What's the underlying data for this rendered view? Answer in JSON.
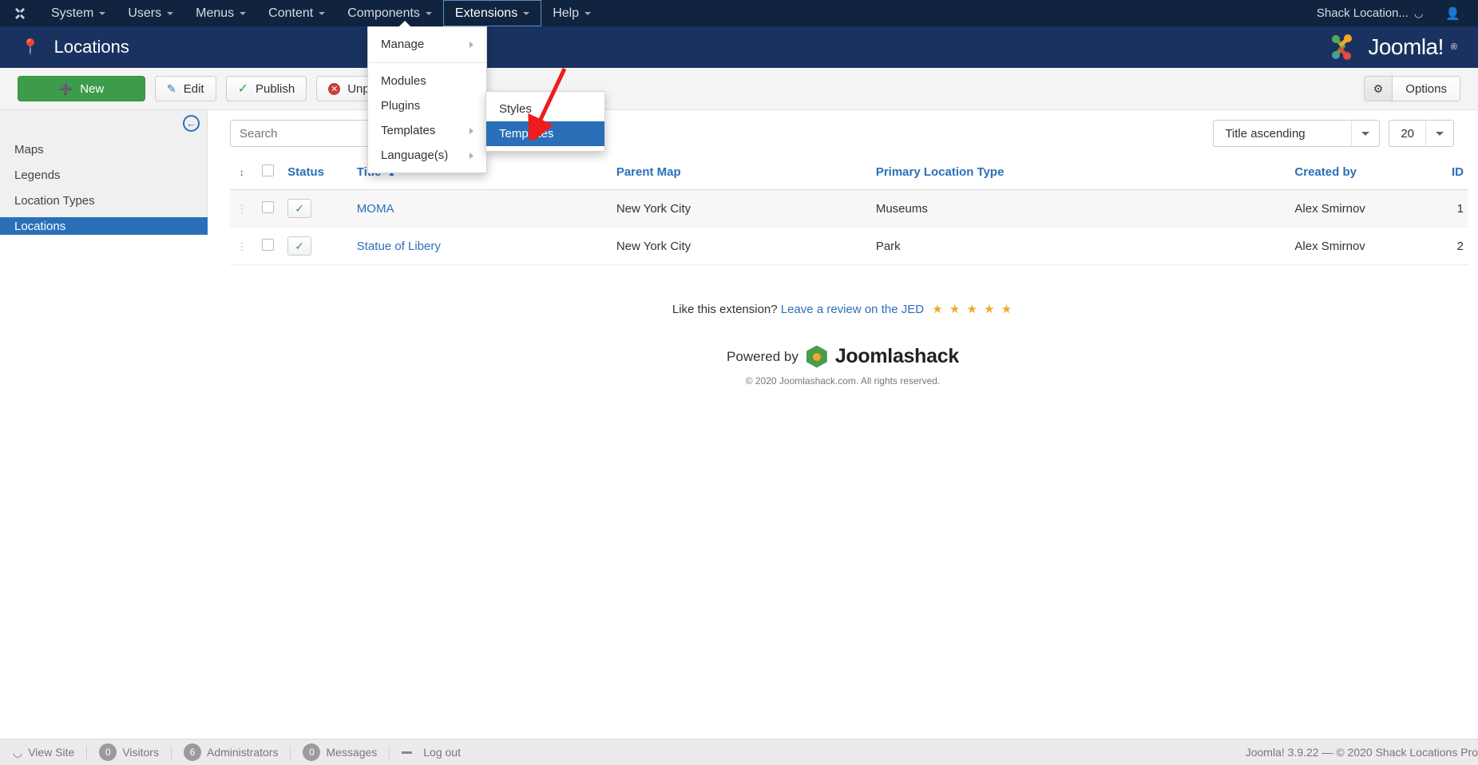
{
  "admin_bar": {
    "logo_icon": "joomla-logo-icon",
    "menus": [
      {
        "label": "System",
        "has_caret": true,
        "open": false
      },
      {
        "label": "Users",
        "has_caret": true,
        "open": false
      },
      {
        "label": "Menus",
        "has_caret": true,
        "open": false
      },
      {
        "label": "Content",
        "has_caret": true,
        "open": false
      },
      {
        "label": "Components",
        "has_caret": true,
        "open": false
      },
      {
        "label": "Extensions",
        "has_caret": true,
        "open": true
      },
      {
        "label": "Help",
        "has_caret": true,
        "open": false
      }
    ],
    "site_name": "Shack Location...",
    "external_icon": "external-link-icon",
    "user_icon": "user-icon"
  },
  "dropdown": {
    "items": [
      {
        "label": "Manage",
        "submenu": true
      },
      {
        "label": "Modules",
        "submenu": false
      },
      {
        "label": "Plugins",
        "submenu": false
      },
      {
        "label": "Templates",
        "submenu": true
      },
      {
        "label": "Language(s)",
        "submenu": true
      }
    ]
  },
  "submenu": {
    "items": [
      {
        "label": "Styles",
        "active": false
      },
      {
        "label": "Templates",
        "active": true
      }
    ]
  },
  "page_header": {
    "icon": "map-marker-icon",
    "title": "Locations",
    "brand": "Joomla!",
    "brand_reg": "®"
  },
  "toolbar": {
    "new_label": "New",
    "new_icon": "plus-circle-icon",
    "edit_label": "Edit",
    "edit_icon": "pencil-square-icon",
    "publish_label": "Publish",
    "publish_icon": "check-icon",
    "unpublish_label": "Unpublish",
    "unpublish_icon": "times-circle-icon",
    "check_icon": "checkbox-icon",
    "options_label": "Options",
    "options_icon": "gear-icon"
  },
  "sidebar": {
    "collapse_icon": "arrow-left-circle-icon",
    "items": [
      {
        "label": "Maps",
        "active": false
      },
      {
        "label": "Legends",
        "active": false
      },
      {
        "label": "Location Types",
        "active": false
      },
      {
        "label": "Locations",
        "active": true
      }
    ]
  },
  "filters": {
    "search_placeholder": "Search",
    "search_value": "",
    "search_icon": "search-icon",
    "clear_icon": "times-icon",
    "tools_label": "",
    "sort_value": "Title ascending",
    "limit_value": "20"
  },
  "table": {
    "columns": [
      {
        "key": "ordering",
        "label": "",
        "icon": "sort-icon"
      },
      {
        "key": "checkall",
        "label": "",
        "icon": "checkbox-icon"
      },
      {
        "key": "status",
        "label": "Status"
      },
      {
        "key": "title",
        "label": "Title",
        "sorted": "asc"
      },
      {
        "key": "parent_map",
        "label": "Parent Map"
      },
      {
        "key": "primary_location_type",
        "label": "Primary Location Type"
      },
      {
        "key": "created_by",
        "label": "Created by"
      },
      {
        "key": "id",
        "label": "ID"
      }
    ],
    "rows": [
      {
        "handle_icon": "drag-handle-icon",
        "status_icon": "check-icon",
        "title": "MOMA",
        "parent_map": "New York City",
        "primary_location_type": "Museums",
        "created_by": "Alex Smirnov",
        "id": "1"
      },
      {
        "handle_icon": "drag-handle-icon",
        "status_icon": "check-icon",
        "title": "Statue of Libery",
        "parent_map": "New York City",
        "primary_location_type": "Park",
        "created_by": "Alex Smirnov",
        "id": "2"
      }
    ]
  },
  "extension_footer": {
    "like_text": "Like this extension?",
    "review_link": "Leave a review on the JED",
    "stars": "★ ★ ★ ★ ★",
    "powered_by": "Powered by",
    "vendor": "Joomlashack",
    "copyright": "© 2020 Joomlashack.com. All rights reserved."
  },
  "status_bar": {
    "view_site": "View Site",
    "view_site_icon": "external-link-icon",
    "visitors_count": "0",
    "visitors_label": "Visitors",
    "administrators_count": "6",
    "administrators_label": "Administrators",
    "messages_count": "0",
    "messages_label": "Messages",
    "logout_label": "Log out",
    "logout_icon": "minus-icon",
    "version_text": "Joomla! 3.9.22  —  © 2020 Shack Locations Pro"
  },
  "annotation": {
    "arrow_color": "#ee1c1c",
    "points_to": "Templates"
  },
  "colors": {
    "admin_bar": "#10243f",
    "title_bar": "#1a3260",
    "accent_blue": "#2a70b8",
    "green": "#3c9c4b",
    "red": "#c73b3b"
  }
}
